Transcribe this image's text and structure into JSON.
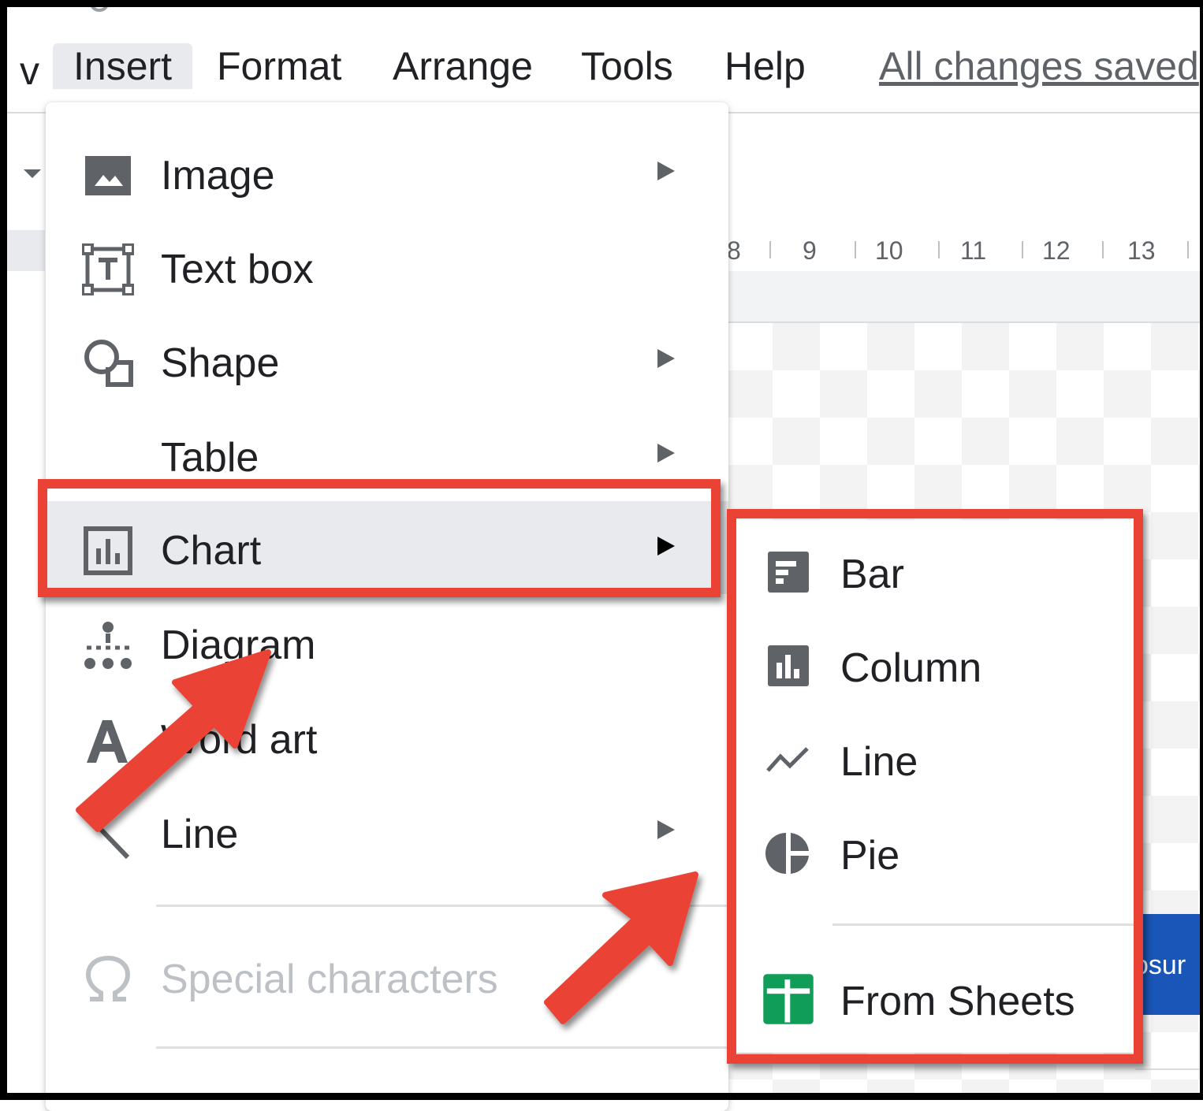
{
  "menubar": {
    "partial_left": "v",
    "tabs": [
      {
        "label": "Insert"
      },
      {
        "label": "Format"
      },
      {
        "label": "Arrange"
      },
      {
        "label": "Tools"
      },
      {
        "label": "Help"
      }
    ],
    "save_status": "All changes saved"
  },
  "ruler": {
    "numbers": [
      "8",
      "9",
      "10",
      "11",
      "12",
      "13"
    ]
  },
  "canvas": {
    "partial_button_text": "osur"
  },
  "insert_menu": {
    "items": [
      {
        "label": "Image",
        "icon": "image-icon",
        "submenu": true
      },
      {
        "label": "Text box",
        "icon": "text-box-icon",
        "submenu": false
      },
      {
        "label": "Shape",
        "icon": "shape-icon",
        "submenu": true
      },
      {
        "label": "Table",
        "icon": "",
        "submenu": true
      },
      {
        "label": "Chart",
        "icon": "chart-icon",
        "submenu": true,
        "highlighted": true
      },
      {
        "label": "Diagram",
        "icon": "diagram-icon",
        "submenu": false
      },
      {
        "label": "Word art",
        "icon": "word-art-icon",
        "submenu": false
      },
      {
        "label": "Line",
        "icon": "line-icon",
        "submenu": true
      },
      {
        "label": "Special characters",
        "icon": "omega-icon",
        "submenu": false,
        "disabled": true
      }
    ]
  },
  "chart_submenu": {
    "items": [
      {
        "label": "Bar",
        "icon": "bar-chart-icon"
      },
      {
        "label": "Column",
        "icon": "column-chart-icon"
      },
      {
        "label": "Line",
        "icon": "line-chart-icon"
      },
      {
        "label": "Pie",
        "icon": "pie-chart-icon"
      },
      {
        "label": "From Sheets",
        "icon": "sheets-icon"
      }
    ]
  },
  "colors": {
    "annotation_red": "#ea4335",
    "menu_highlight": "#e8eaed",
    "sheets_green": "#0f9d58",
    "canvas_blue": "#1a56b8"
  }
}
